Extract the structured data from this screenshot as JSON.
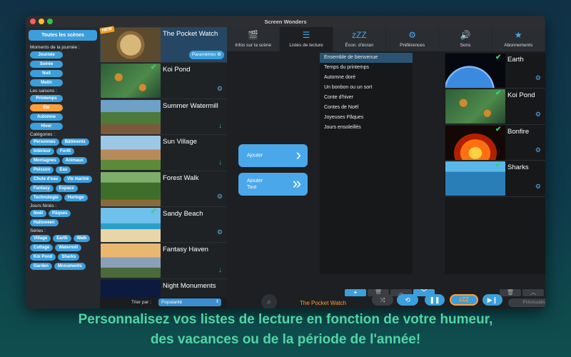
{
  "window": {
    "title": "Screen Wonders"
  },
  "sidebar": {
    "all_scenes": "Toutes les scènes",
    "sections": [
      {
        "label": "Moments de la journée :",
        "chips": [
          {
            "text": "Journée",
            "wide": true
          },
          {
            "text": "Soirée",
            "wide": true
          },
          {
            "text": "Nuit",
            "wide": true
          },
          {
            "text": "Matin",
            "wide": true
          }
        ]
      },
      {
        "label": "Les saisons :",
        "chips": [
          {
            "text": "Printemps",
            "wide": true
          },
          {
            "text": "Été",
            "wide": true,
            "active": true
          },
          {
            "text": "Automne",
            "wide": true
          },
          {
            "text": "Hiver",
            "wide": true
          }
        ]
      },
      {
        "label": "Catégories :",
        "chips": [
          {
            "text": "Personnes"
          },
          {
            "text": "Bâtiments"
          },
          {
            "text": "Intérieur"
          },
          {
            "text": "Forêt"
          },
          {
            "text": "Montagnes"
          },
          {
            "text": "Animaux"
          },
          {
            "text": "Poisson"
          },
          {
            "text": "Eau"
          },
          {
            "text": "Chute d'eau"
          },
          {
            "text": "Vie marine"
          },
          {
            "text": "Fantasy"
          },
          {
            "text": "Espace"
          },
          {
            "text": "Technologie"
          },
          {
            "text": "Horloge"
          }
        ]
      },
      {
        "label": "Jours fériés :",
        "chips": [
          {
            "text": "Noël"
          },
          {
            "text": "Pâques"
          },
          {
            "text": "Halloween"
          }
        ]
      },
      {
        "label": "Séries :",
        "chips": [
          {
            "text": "Village"
          },
          {
            "text": "Earth"
          },
          {
            "text": "Walk"
          },
          {
            "text": "Cottage"
          },
          {
            "text": "Watermill"
          },
          {
            "text": "Koi Pond"
          },
          {
            "text": "Sharks"
          },
          {
            "text": "Garden"
          },
          {
            "text": "Monuments"
          }
        ]
      }
    ]
  },
  "scenes": [
    {
      "title": "The Pocket Watch",
      "status": "params",
      "selected": true,
      "badge": "NEW",
      "params_label": "Paramètres"
    },
    {
      "title": "Koi Pond",
      "status": "gear",
      "checked": true
    },
    {
      "title": "Summer Watermill",
      "status": "download"
    },
    {
      "title": "Sun Village",
      "status": "download"
    },
    {
      "title": "Forest Walk",
      "status": "gear"
    },
    {
      "title": "Sandy Beach",
      "status": "gear",
      "checked": true
    },
    {
      "title": "Fantasy Haven",
      "status": "download"
    },
    {
      "title": "Night Monuments",
      "status": "none"
    }
  ],
  "sort": {
    "label": "Trier par :",
    "value": "Popularité"
  },
  "tabs": [
    {
      "label": "Infos sur la scène",
      "icon": "film-reel-icon",
      "glyph": "🎬",
      "active": false
    },
    {
      "label": "Listes de lecture",
      "icon": "list-icon",
      "glyph": "☰",
      "active": true
    },
    {
      "label": "Écon. d'écran",
      "icon": "screensaver-icon",
      "glyph": "zZZ",
      "active": false
    },
    {
      "label": "Préférences",
      "icon": "gears-icon",
      "glyph": "⚙",
      "active": false
    },
    {
      "label": "Sons",
      "icon": "speaker-icon",
      "glyph": "🔊",
      "active": false
    },
    {
      "label": "Abonnements",
      "icon": "star-icon",
      "glyph": "★",
      "active": false
    }
  ],
  "actions": {
    "add": "Ajouter",
    "add_all_line1": "Ajouter",
    "add_all_line2": "Tout"
  },
  "playlists": [
    {
      "name": "Ensemble de bienvenue",
      "selected": true
    },
    {
      "name": "Temps du printemps"
    },
    {
      "name": "Automne doré"
    },
    {
      "name": "Un bonbon ou un sort"
    },
    {
      "name": "Conte d'hiver"
    },
    {
      "name": "Contes de Noël"
    },
    {
      "name": "Joyeuses Pâques"
    },
    {
      "name": "Jours ensoleillés"
    }
  ],
  "playlist_scenes": [
    {
      "title": "Earth",
      "checked": true
    },
    {
      "title": "Koi Pond",
      "checked": true
    },
    {
      "title": "Bonfire",
      "checked": true
    },
    {
      "title": "Sharks",
      "checked": true
    }
  ],
  "player": {
    "current_scene": "The Pocket Watch",
    "preview": "Prévisualiser",
    "sleep_label": "zZZ"
  },
  "caption": {
    "line1": "Personnalisez vos listes de lecture en fonction de votre humeur,",
    "line2": "des vacances ou de la période de l'année!"
  },
  "colors": {
    "accent": "#3c9fdc",
    "active_chip": "#ff9f3a",
    "caption": "#4fd6a4",
    "current_scene": "#ff9f3a"
  }
}
